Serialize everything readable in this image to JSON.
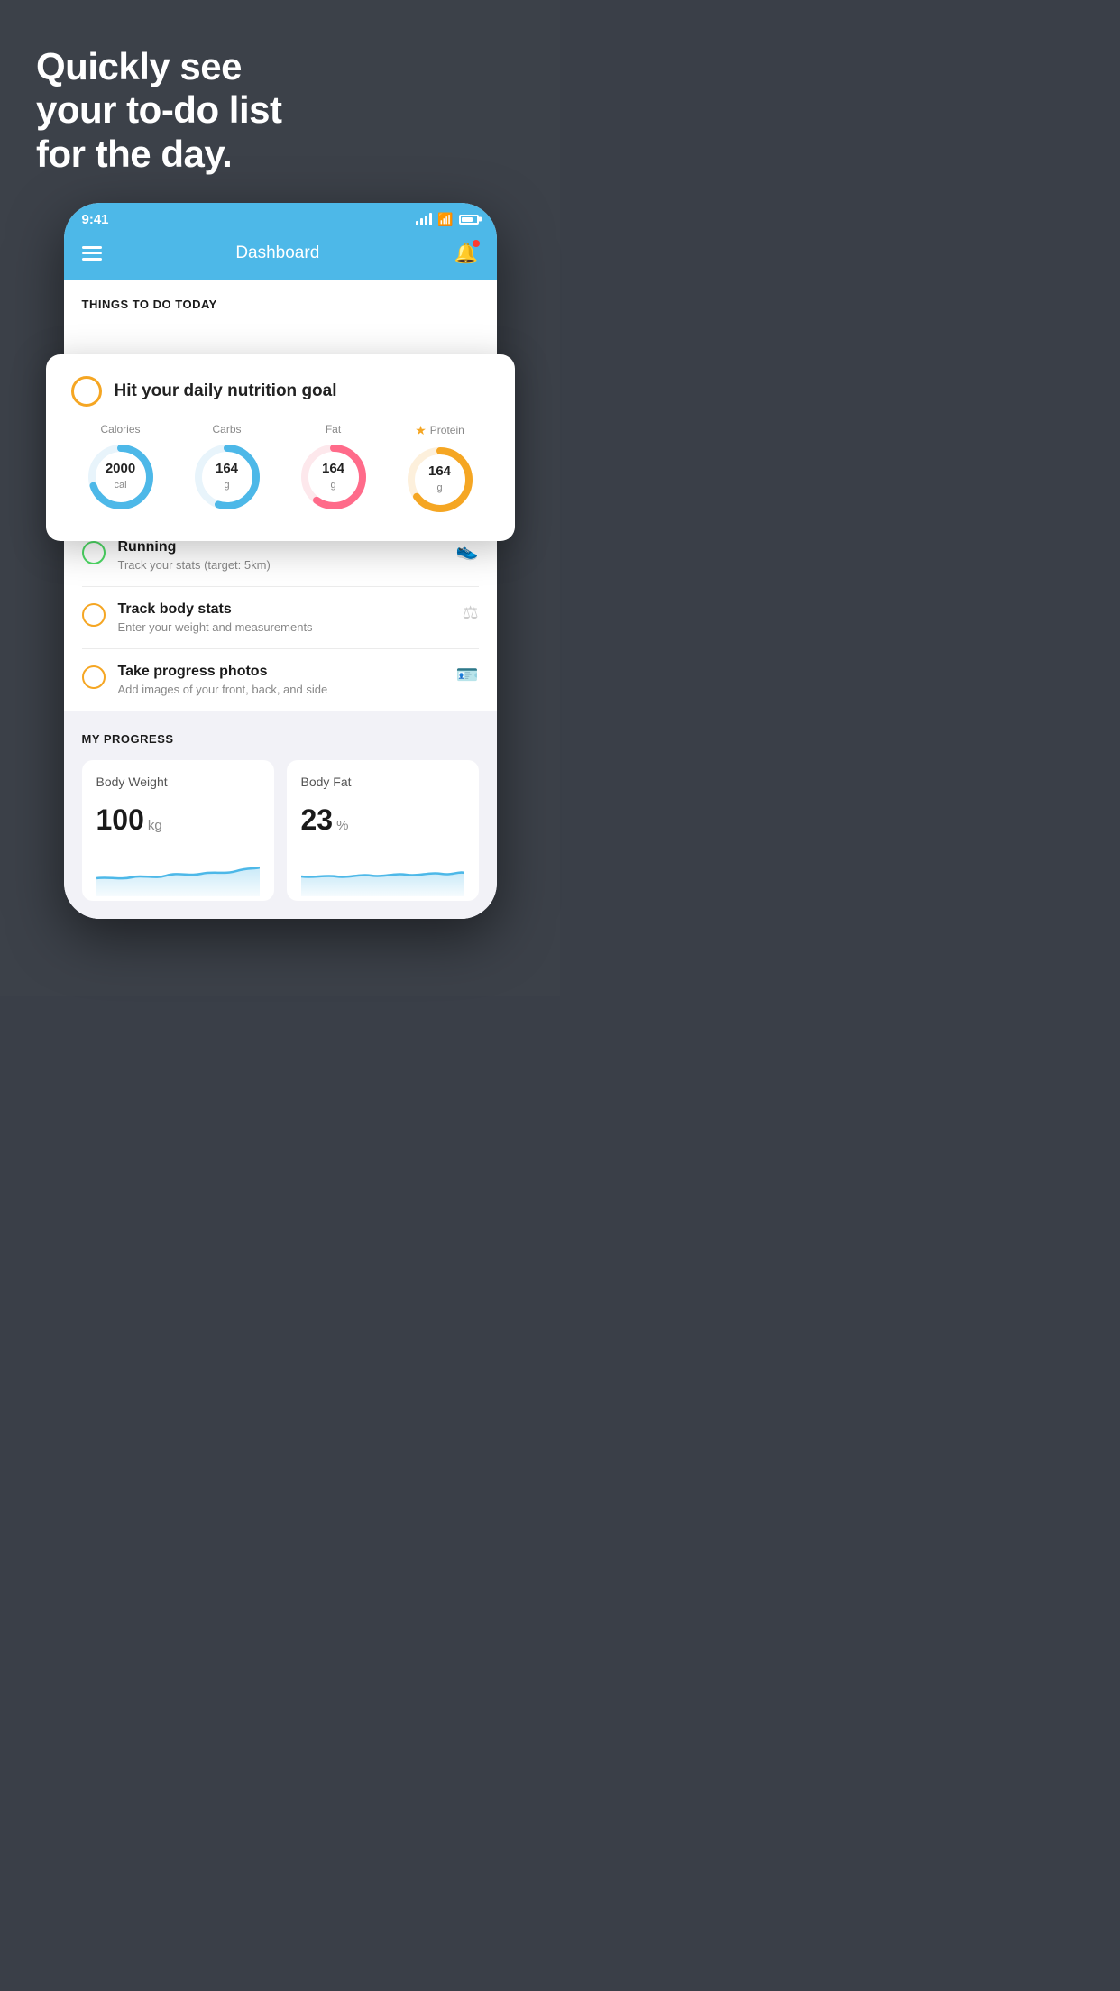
{
  "hero": {
    "title_line1": "Quickly see",
    "title_line2": "your to-do list",
    "title_line3": "for the day."
  },
  "status_bar": {
    "time": "9:41"
  },
  "app_header": {
    "title": "Dashboard"
  },
  "things_today": {
    "section_label": "THINGS TO DO TODAY"
  },
  "floating_card": {
    "title": "Hit your daily nutrition goal",
    "items": [
      {
        "label": "Calories",
        "value": "2000",
        "unit": "cal",
        "color": "#4db8e8",
        "pct": 70,
        "starred": false
      },
      {
        "label": "Carbs",
        "value": "164",
        "unit": "g",
        "color": "#4db8e8",
        "pct": 55,
        "starred": false
      },
      {
        "label": "Fat",
        "value": "164",
        "unit": "g",
        "color": "#ff6b8a",
        "pct": 60,
        "starred": false
      },
      {
        "label": "Protein",
        "value": "164",
        "unit": "g",
        "color": "#f5a623",
        "pct": 65,
        "starred": true
      }
    ]
  },
  "todo_items": [
    {
      "title": "Running",
      "subtitle": "Track your stats (target: 5km)",
      "circle_color": "green",
      "icon": "👟"
    },
    {
      "title": "Track body stats",
      "subtitle": "Enter your weight and measurements",
      "circle_color": "yellow",
      "icon": "⚖"
    },
    {
      "title": "Take progress photos",
      "subtitle": "Add images of your front, back, and side",
      "circle_color": "yellow",
      "icon": "🪪"
    }
  ],
  "progress": {
    "section_label": "MY PROGRESS",
    "cards": [
      {
        "title": "Body Weight",
        "value": "100",
        "unit": "kg"
      },
      {
        "title": "Body Fat",
        "value": "23",
        "unit": "%"
      }
    ]
  }
}
